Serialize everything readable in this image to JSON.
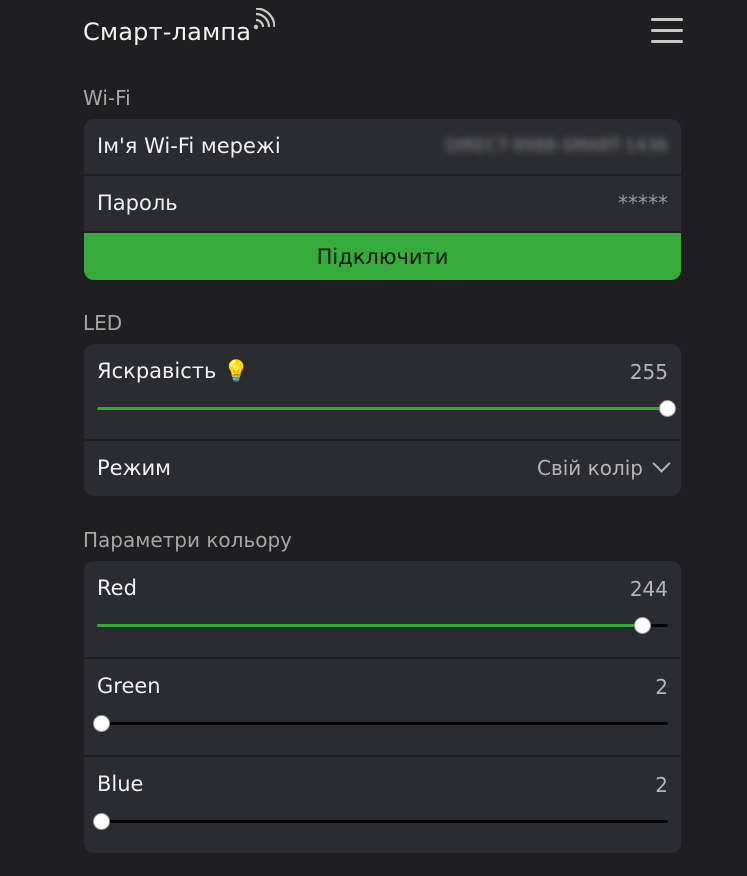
{
  "header": {
    "title": "Смарт-лампа",
    "wifi_icon": "wifi-signal-icon",
    "menu_icon": "hamburger-menu-icon"
  },
  "wifi": {
    "section_title": "Wi-Fi",
    "ssid_label": "Ім'я Wi-Fi мережі",
    "ssid_value": "DIRECT-9988-SMART-1436",
    "password_label": "Пароль",
    "password_value": "*****",
    "connect_label": "Підключити"
  },
  "led": {
    "section_title": "LED",
    "brightness_label": "Яскравість 💡",
    "brightness_value": "255",
    "brightness_level": 1.0,
    "mode_label": "Режим",
    "mode_value": "Свій колір"
  },
  "color": {
    "section_title": "Параметри кольору",
    "red_label": "Red",
    "red_value": "244",
    "red_level": 0.957,
    "green_label": "Green",
    "green_value": "2",
    "green_level": 0.008,
    "blue_label": "Blue",
    "blue_value": "2",
    "blue_level": 0.008
  },
  "colors": {
    "accent": "#36aa3a",
    "background": "#1f1f21",
    "card": "#2b2c31"
  }
}
